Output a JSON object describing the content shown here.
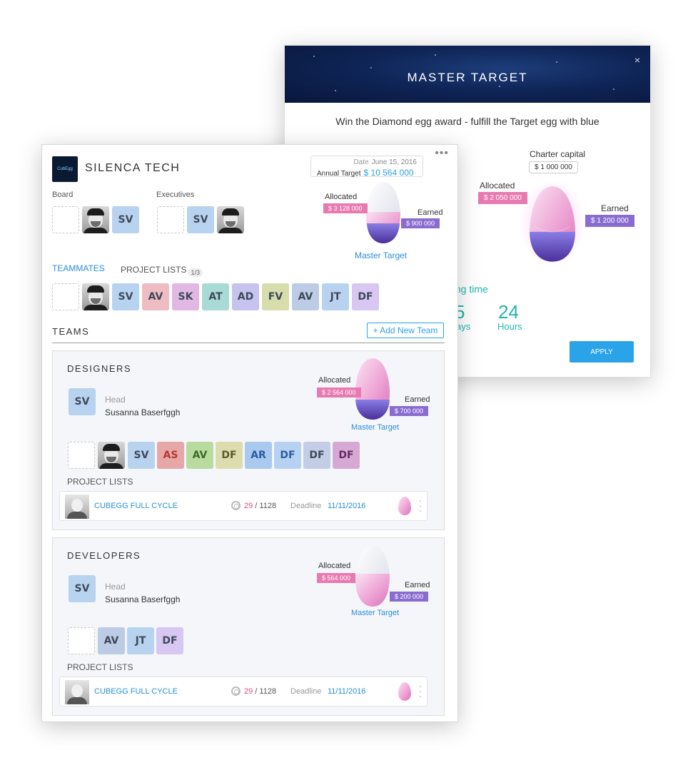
{
  "modal": {
    "title": "MASTER TARGET",
    "close_glyph": "×",
    "subtitle": "Win the Diamond egg award - fulfill  the Target egg with blue",
    "charter_label": "Charter capital",
    "charter_value": "$ 1 000 000",
    "allocated_label": "Allocated",
    "allocated_value": "$ 2 050 000",
    "earned_label": "Earned",
    "earned_value": "$ 1 200 000",
    "remaining_label": "ning time",
    "days_value": "5",
    "days_label": "ays",
    "hours_value": "24",
    "hours_label": "Hours",
    "apply_label": "APPLY"
  },
  "header": {
    "logo_text": "CubEgg",
    "company": "SILENCA TECH",
    "more": "•••",
    "date_label": "Date",
    "date_value": "June 15, 2016",
    "target_label": "Annual  Target",
    "target_value": "$ 10 564 000"
  },
  "board": {
    "label": "Board",
    "initials": "SV"
  },
  "executives": {
    "label": "Executives",
    "initials": "SV"
  },
  "company_target": {
    "allocated_label": "Allocated",
    "allocated_value": "$ 3 128 000",
    "earned_label": "Earned",
    "earned_value": "$ 900 000",
    "master_label": "Master Target"
  },
  "tabs": {
    "teammates": "TEAMMATES",
    "project_lists": "PROJECT LISTS",
    "badge": "1/3"
  },
  "teammates": [
    {
      "initials": "SV",
      "color": "#b8d3ef"
    },
    {
      "initials": "AV",
      "color": "#efbcc4"
    },
    {
      "initials": "SK",
      "color": "#e1b7e3"
    },
    {
      "initials": "AT",
      "color": "#a8dbd6"
    },
    {
      "initials": "AD",
      "color": "#c6c3ef"
    },
    {
      "initials": "FV",
      "color": "#d7ddab"
    },
    {
      "initials": "AV",
      "color": "#bccce4"
    },
    {
      "initials": "JT",
      "color": "#b8d3ef"
    },
    {
      "initials": "DF",
      "color": "#d8c6f3"
    }
  ],
  "teams_title": "TEAMS",
  "add_team_label": "+ Add New Team",
  "designers": {
    "name": "DESIGNERS",
    "head_initials": "SV",
    "head_label": "Head",
    "head_name": "Susanna Baserfggh",
    "allocated_label": "Allocated",
    "allocated_value": "$ 2 564 000",
    "earned_label": "Earned",
    "earned_value": "$ 700 000",
    "master_label": "Master Target",
    "members": [
      {
        "initials": "SV",
        "color": "#b8d3ef",
        "text": "#3f4a5a"
      },
      {
        "initials": "AS",
        "color": "#e6a7a7",
        "text": "#b73838"
      },
      {
        "initials": "AV",
        "color": "#b9dba0",
        "text": "#3f6a2a"
      },
      {
        "initials": "DF",
        "color": "#dcdcae",
        "text": "#5b5b30"
      },
      {
        "initials": "AR",
        "color": "#a9c9ef",
        "text": "#2a5fa3"
      },
      {
        "initials": "DF",
        "color": "#b6d1f2",
        "text": "#2a5fa3"
      },
      {
        "initials": "DF",
        "color": "#c4cde6",
        "text": "#3f4a5a"
      },
      {
        "initials": "DF",
        "color": "#d6a9d4",
        "text": "#6a2a66"
      }
    ],
    "project_lists_label": "PROJECT LISTS",
    "project": {
      "name": "CUBEGG FULL CYCLE",
      "done": "29",
      "total": " / 1128",
      "deadline_label": "Deadline",
      "deadline": "11/11/2016"
    }
  },
  "developers": {
    "name": "DEVELOPERS",
    "head_initials": "SV",
    "head_label": "Head",
    "head_name": "Susanna Baserfggh",
    "allocated_label": "Allocated",
    "allocated_value": "$  564 000",
    "earned_label": "Earned",
    "earned_value": "$ 200 000",
    "master_label": "Master Target",
    "members": [
      {
        "initials": "AV",
        "color": "#bccce4",
        "text": "#3f4a5a"
      },
      {
        "initials": "JT",
        "color": "#b8d3ef",
        "text": "#3f4a5a"
      },
      {
        "initials": "DF",
        "color": "#d8c6f3",
        "text": "#3f4a5a"
      }
    ],
    "project_lists_label": "PROJECT LISTS",
    "project": {
      "name": "CUBEGG FULL CYCLE",
      "done": "29",
      "total": " / 1128",
      "deadline_label": "Deadline",
      "deadline": "11/11/2016"
    }
  }
}
